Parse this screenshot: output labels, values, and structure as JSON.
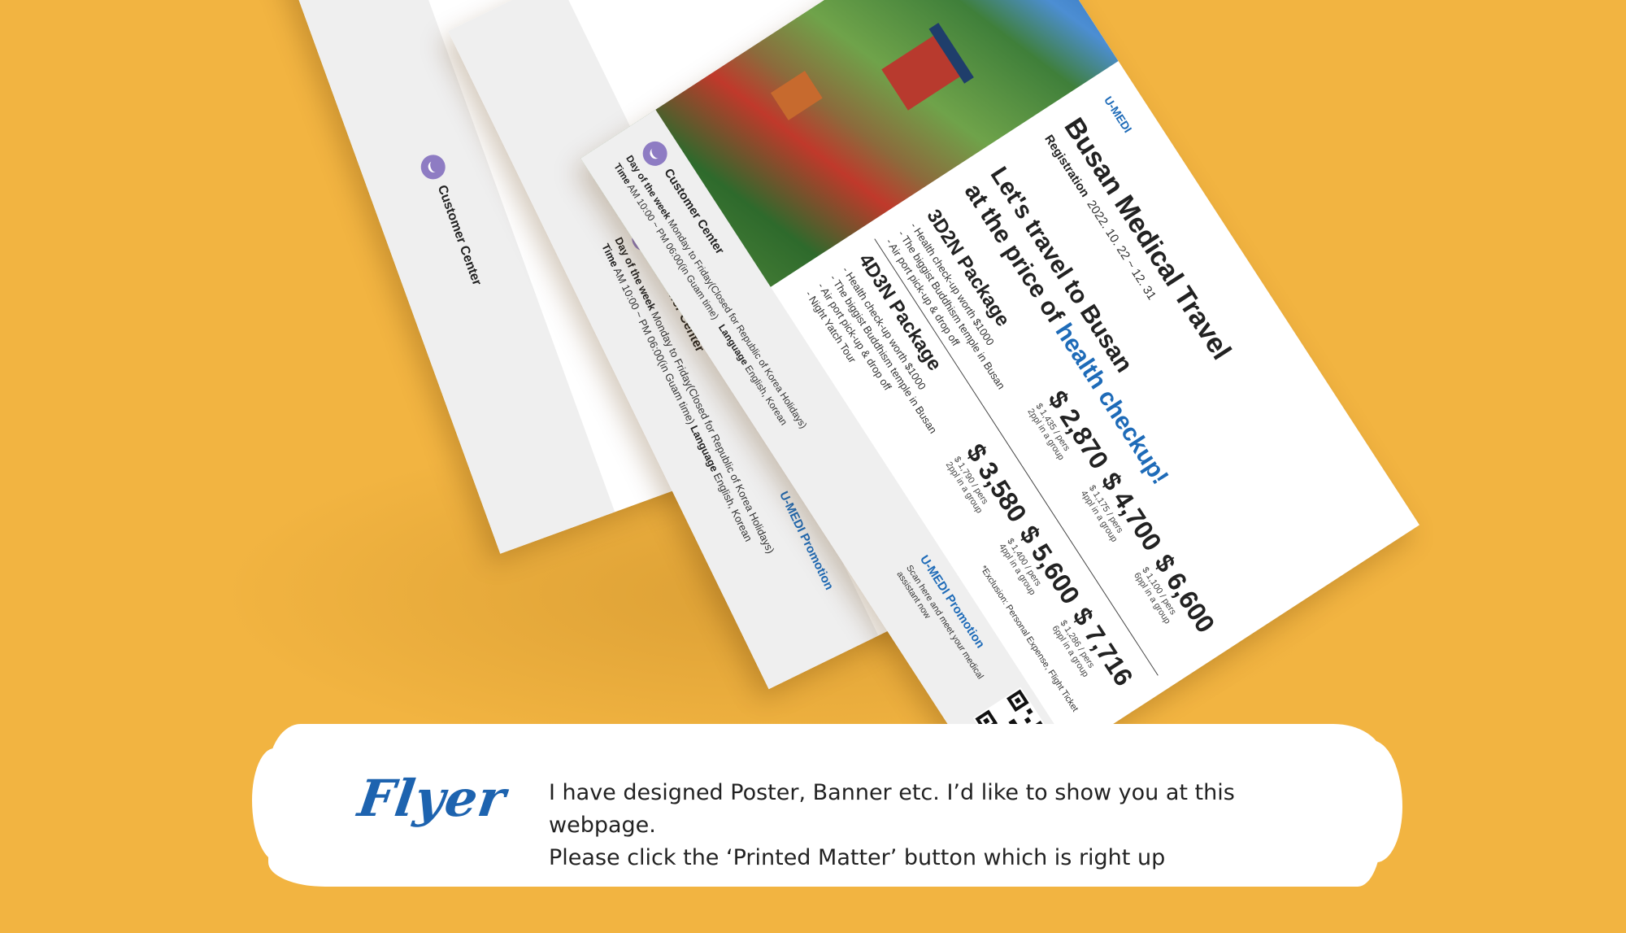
{
  "colors": {
    "background": "#F2B441",
    "accent_blue": "#1D63AF",
    "banner_white": "#FFFFFF"
  },
  "flyer_main": {
    "brand": "U-MEDI",
    "title": "Busan Medical Travel",
    "registration_label": "Registration",
    "registration_dates": "2022. 10. 22 ~ 12. 31",
    "headline_line1": "Let's travel to Busan",
    "headline_line2_prefix": "at the price of ",
    "headline_line2_highlight": "health checkup!",
    "package_3d2n": {
      "title": "3D2N Package",
      "items": [
        "- Health check-up worth $1000",
        "- The biggist Buddhism temple in Busan",
        "- Air port pick-up & drop off"
      ]
    },
    "package_4d3n": {
      "title": "4D3N Package",
      "items": [
        "- Health check-up worth $1000",
        "- The biggist Buddhism temple in Busan",
        "- Air port pick-up & drop off",
        "- Night Yatch Tour"
      ]
    },
    "prices": [
      {
        "amount": "$ 2,870",
        "per": "$ 1,435 / pers",
        "group": "2ppl in a group"
      },
      {
        "amount": "$ 4,700",
        "per": "$ 1,175 / pers",
        "group": "4ppl in a group"
      },
      {
        "amount": "$ 6,600",
        "per": "$ 1,100 / pers",
        "group": "6ppl in a group"
      },
      {
        "amount": "$ 3,580",
        "per": "$ 1,790 / pers",
        "group": "2ppl in a group"
      },
      {
        "amount": "$ 5,600",
        "per": "$ 1,400 / pers",
        "group": "4ppl in a group"
      },
      {
        "amount": "$ 7,716",
        "per": "$ 1,286 / pers",
        "group": "6ppl in a group"
      }
    ],
    "exclusion": "*Exclusion: Personal Expense, Flight Ticket",
    "customer_center": {
      "title": "Customer Center",
      "days_label": "Day of the week",
      "days_value": "Monday to Friday(Closed for Republic of Korea Holidays)",
      "time_label": "Time",
      "time_value": "AM 10:00 ~ PM 06:00(in Guam time)",
      "language_label": "Language",
      "language_value": "English, Korean"
    },
    "promo_title": "U-MEDI Promotion",
    "promo_text": "Scan here and meet your medical assistant now"
  },
  "banner": {
    "title": "Flyer",
    "line1": "I have designed Poster, Banner etc. I’d like to show you at this webpage.",
    "line2": "Please click the ‘Printed Matter’ button which is right up"
  }
}
